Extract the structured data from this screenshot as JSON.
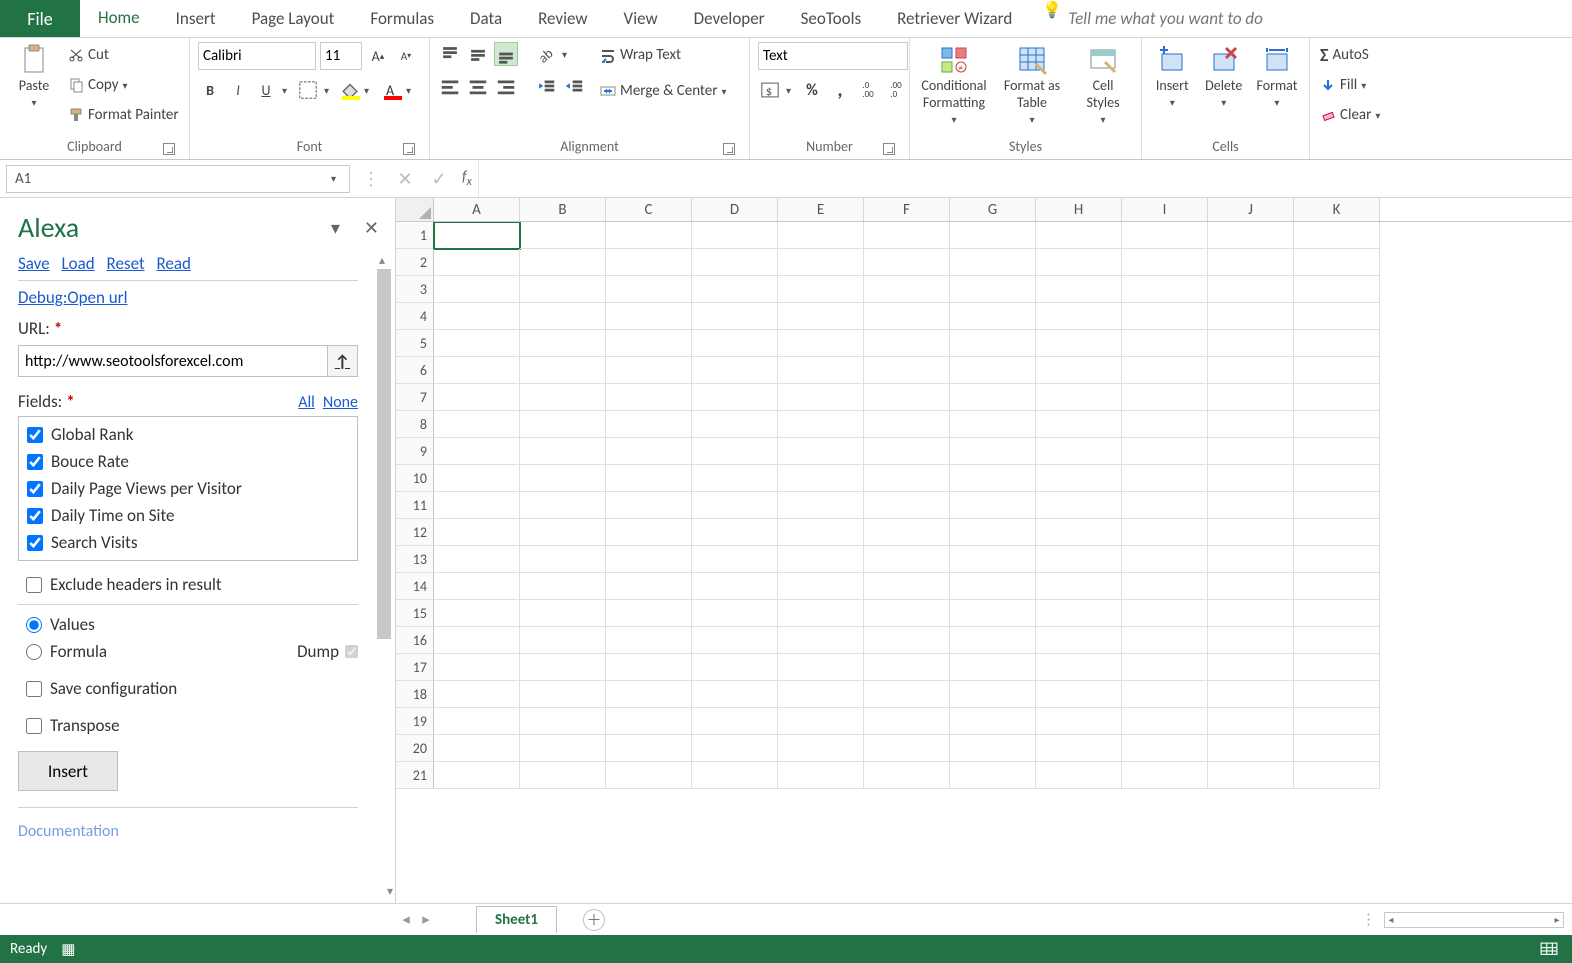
{
  "tabs": {
    "file": "File",
    "list": [
      "Home",
      "Insert",
      "Page Layout",
      "Formulas",
      "Data",
      "Review",
      "View",
      "Developer",
      "SeoTools",
      "Retriever Wizard"
    ],
    "active": "Home",
    "tellme": "Tell me what you want to do"
  },
  "clipboard": {
    "paste": "Paste",
    "cut": "Cut",
    "copy": "Copy",
    "painter": "Format Painter",
    "label": "Clipboard"
  },
  "font": {
    "name": "Calibri",
    "size": "11",
    "label": "Font"
  },
  "alignment": {
    "wrap": "Wrap Text",
    "merge": "Merge & Center",
    "label": "Alignment"
  },
  "number": {
    "format": "Text",
    "label": "Number"
  },
  "styles": {
    "cond": "Conditional\nFormatting",
    "fmt_table": "Format as\nTable",
    "cell_styles": "Cell\nStyles",
    "label": "Styles"
  },
  "cells": {
    "insert": "Insert",
    "delete": "Delete",
    "format": "Format",
    "label": "Cells"
  },
  "editing": {
    "autosum": "AutoS",
    "fill": "Fill",
    "clear": "Clear"
  },
  "namebox": "A1",
  "pane": {
    "title": "Alexa",
    "links": {
      "save": "Save",
      "load": "Load",
      "reset": "Reset",
      "read": "Read",
      "debug": "Debug:Open url"
    },
    "url_label": "URL:",
    "url_value": "http://www.seotoolsforexcel.com",
    "fields_label": "Fields:",
    "all": "All",
    "none": "None",
    "fields": [
      "Global Rank",
      "Bouce Rate",
      "Daily Page Views per Visitor",
      "Daily Time on Site",
      "Search Visits"
    ],
    "exclude": "Exclude headers in result",
    "values": "Values",
    "formula": "Formula",
    "dump": "Dump",
    "savecfg": "Save configuration",
    "transpose": "Transpose",
    "insert": "Insert",
    "doc": "Documentation"
  },
  "columns": [
    "A",
    "B",
    "C",
    "D",
    "E",
    "F",
    "G",
    "H",
    "I",
    "J",
    "K"
  ],
  "rows": 21,
  "sheet": "Sheet1",
  "status": "Ready"
}
